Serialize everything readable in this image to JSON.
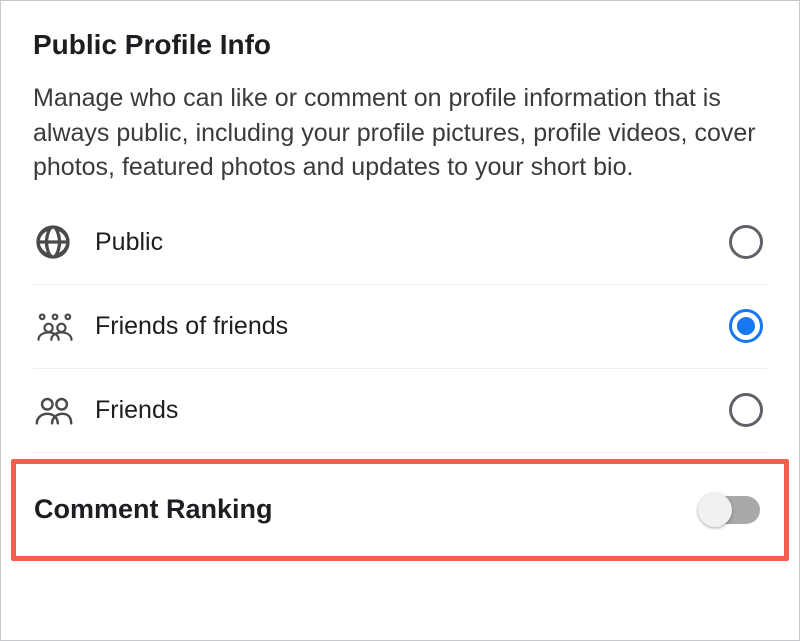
{
  "section": {
    "title": "Public Profile Info",
    "description": "Manage who can like or comment on profile information that is always public, including your profile pictures, profile videos, cover photos, featured photos and updates to your short bio."
  },
  "options": [
    {
      "id": "public",
      "label": "Public",
      "icon": "globe-icon",
      "selected": false
    },
    {
      "id": "fof",
      "label": "Friends of friends",
      "icon": "fof-icon",
      "selected": true
    },
    {
      "id": "friends",
      "label": "Friends",
      "icon": "friends-icon",
      "selected": false
    }
  ],
  "toggle": {
    "label": "Comment Ranking",
    "on": false
  },
  "colors": {
    "accent": "#1877f2",
    "highlight": "#f2604e"
  }
}
